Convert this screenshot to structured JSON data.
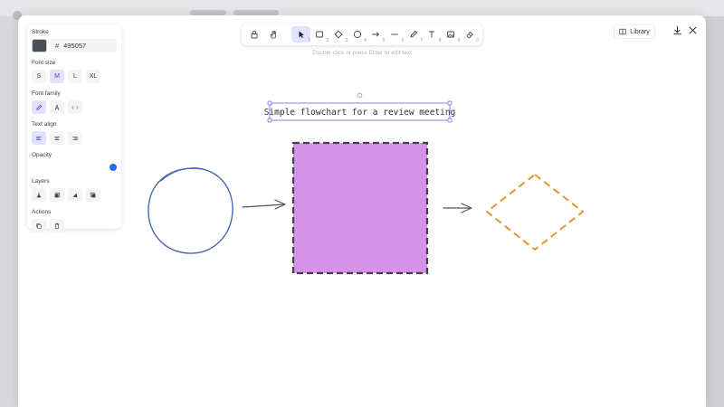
{
  "toolbar": {
    "tools": [
      {
        "name": "lock-tool",
        "icon": "lock-icon",
        "key": "",
        "active": false
      },
      {
        "name": "hand-tool",
        "icon": "hand-icon",
        "key": "",
        "active": false
      },
      {
        "name": "selection-tool",
        "icon": "pointer-icon",
        "key": "1",
        "active": true
      },
      {
        "name": "rectangle-tool",
        "icon": "rectangle-icon",
        "key": "2",
        "active": false
      },
      {
        "name": "diamond-tool",
        "icon": "diamond-icon",
        "key": "3",
        "active": false
      },
      {
        "name": "ellipse-tool",
        "icon": "ellipse-icon",
        "key": "4",
        "active": false
      },
      {
        "name": "arrow-tool",
        "icon": "arrow-icon",
        "key": "5",
        "active": false
      },
      {
        "name": "line-tool",
        "icon": "line-icon",
        "key": "6",
        "active": false
      },
      {
        "name": "draw-tool",
        "icon": "pencil-icon",
        "key": "7",
        "active": false
      },
      {
        "name": "text-tool",
        "icon": "text-icon",
        "key": "8",
        "active": false
      },
      {
        "name": "image-tool",
        "icon": "image-icon",
        "key": "9",
        "active": false
      },
      {
        "name": "eraser-tool",
        "icon": "eraser-icon",
        "key": "0",
        "active": false
      }
    ]
  },
  "hint": "Double-click or press Enter to edit text",
  "header": {
    "library_label": "Library"
  },
  "panel": {
    "stroke_label": "Stroke",
    "stroke_hash": "#",
    "stroke_hex": "495057",
    "stroke_color": "#495057",
    "font_size_label": "Font size",
    "font_sizes": [
      "S",
      "M",
      "L",
      "XL"
    ],
    "font_size_selected": "M",
    "font_family_label": "Font family",
    "text_align_label": "Text align",
    "opacity_label": "Opacity",
    "opacity_value": 100,
    "layers_label": "Layers",
    "actions_label": "Actions"
  },
  "canvas": {
    "title_text": "Simple flowchart for a review meeting",
    "colors": {
      "circle_stroke": "#4a68b6",
      "square_fill": "#d692e9",
      "square_stroke": "#3f3f45",
      "diamond_stroke": "#e0952e",
      "arrow_stroke": "#555555",
      "selection": "#6965db"
    }
  }
}
